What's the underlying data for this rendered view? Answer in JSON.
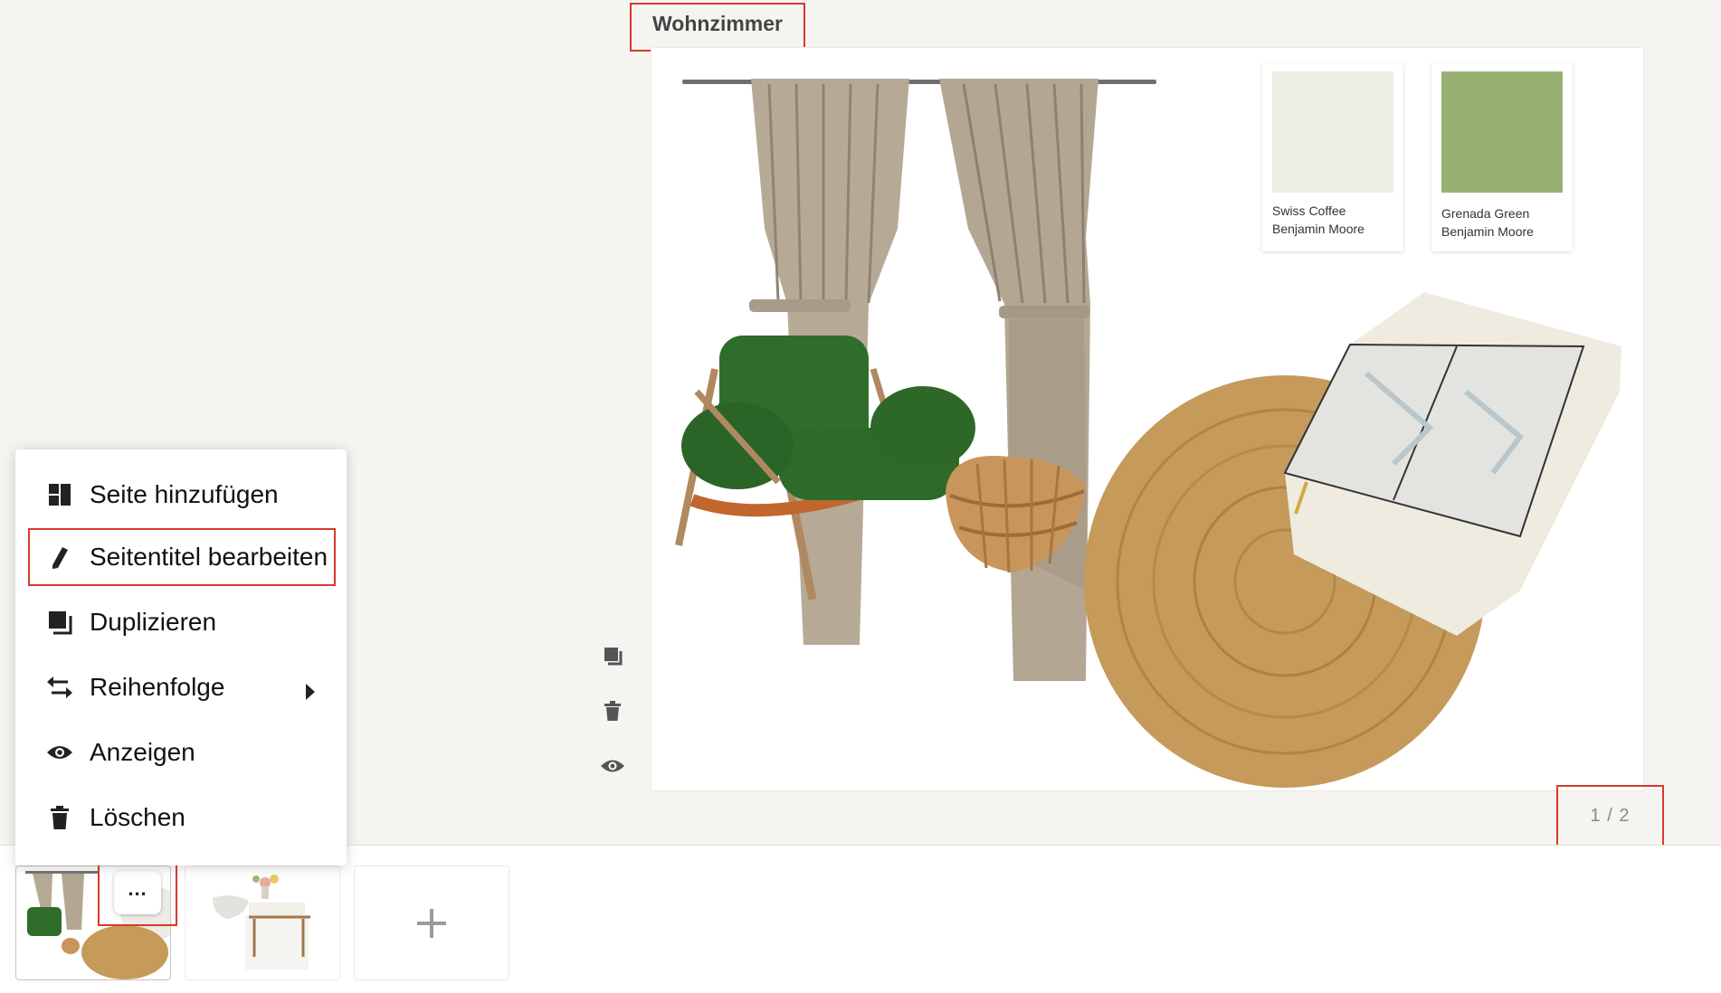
{
  "page": {
    "title": "Wohnzimmer",
    "counter": "1 / 2"
  },
  "board": {
    "swatches": [
      {
        "name": "Swiss Coffee",
        "brand": "Benjamin Moore",
        "color": "#eeeee5"
      },
      {
        "name": "Grenada Green",
        "brand": "Benjamin Moore",
        "color": "#98b173"
      }
    ]
  },
  "side_tools": [
    {
      "icon": "duplicate-icon"
    },
    {
      "icon": "trash-icon"
    },
    {
      "icon": "eye-icon"
    }
  ],
  "context_menu": {
    "items": [
      {
        "label": "Seite hinzufügen",
        "icon": "add-page-icon"
      },
      {
        "label": "Seitentitel bearbeiten",
        "icon": "pencil-icon",
        "selected": true
      },
      {
        "label": "Duplizieren",
        "icon": "duplicate-icon"
      },
      {
        "label": "Reihenfolge",
        "icon": "swap-arrows-icon",
        "submenu": true
      },
      {
        "label": "Anzeigen",
        "icon": "eye-icon"
      },
      {
        "label": "Löschen",
        "icon": "trash-icon"
      }
    ]
  },
  "thumbnails": {
    "more_label": "...",
    "add_label": "+"
  },
  "colors": {
    "highlight": "#d8392b",
    "background": "#f6f4f0"
  }
}
